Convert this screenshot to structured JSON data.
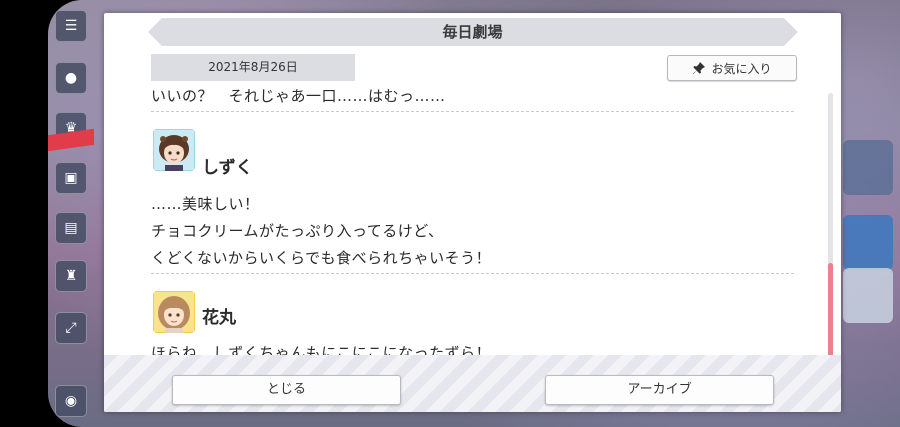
{
  "dialog": {
    "title": "毎日劇場",
    "date": "2021年8月26日",
    "favorite_label": "お気に入り",
    "close_label": "とじる",
    "archive_label": "アーカイブ"
  },
  "lines": {
    "cut_line": "いいの？　それじゃあ一口……はむっ……",
    "shizuku": {
      "name": "しずく",
      "line1": "……美味しい！",
      "line2": "チョコクリームがたっぷり入ってるけど、",
      "line3": "くどくないからいくらでも食べられちゃいそう！"
    },
    "hanamaru": {
      "name": "花丸",
      "line1": "ほらね、しずくちゃんもにこにこになったずら！"
    }
  },
  "scroll": {
    "position_fraction": 1.0
  },
  "colors": {
    "scroll_thumb": "#ee7f8e",
    "title_bar": "#dcdde3"
  }
}
